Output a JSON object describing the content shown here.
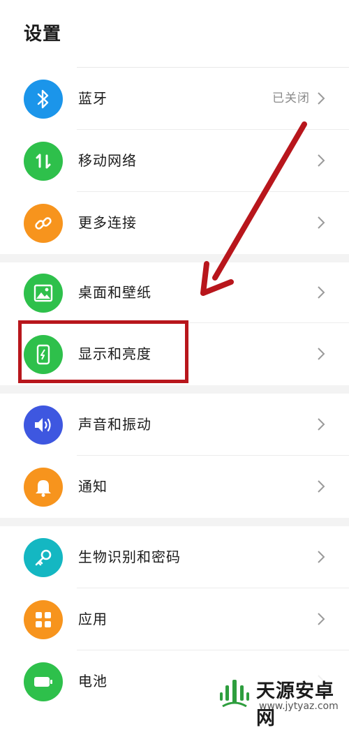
{
  "page": {
    "title": "设置"
  },
  "groups": [
    {
      "items": [
        {
          "label": "蓝牙",
          "value": "已关闭",
          "icon": "bluetooth-icon",
          "color": "#1b95ea"
        },
        {
          "label": "移动网络",
          "value": "",
          "icon": "mobile-data-icon",
          "color": "#2ec04b"
        },
        {
          "label": "更多连接",
          "value": "",
          "icon": "link-icon",
          "color": "#f7941d"
        }
      ]
    },
    {
      "items": [
        {
          "label": "桌面和壁纸",
          "value": "",
          "icon": "wallpaper-icon",
          "color": "#2ec04b"
        },
        {
          "label": "显示和亮度",
          "value": "",
          "icon": "display-brightness-icon",
          "color": "#2ec04b"
        }
      ]
    },
    {
      "items": [
        {
          "label": "声音和振动",
          "value": "",
          "icon": "sound-icon",
          "color": "#3e57e0"
        },
        {
          "label": "通知",
          "value": "",
          "icon": "bell-icon",
          "color": "#f7941d"
        }
      ]
    },
    {
      "items": [
        {
          "label": "生物识别和密码",
          "value": "",
          "icon": "key-icon",
          "color": "#14b7c2"
        },
        {
          "label": "应用",
          "value": "",
          "icon": "apps-icon",
          "color": "#f7941d"
        },
        {
          "label": "电池",
          "value": "",
          "icon": "battery-icon",
          "color": "#2ec04b"
        }
      ]
    }
  ],
  "annotation": {
    "color": "#b8161c"
  },
  "watermark": {
    "name": "天源安卓网",
    "url": "www.jytyaz.com"
  }
}
